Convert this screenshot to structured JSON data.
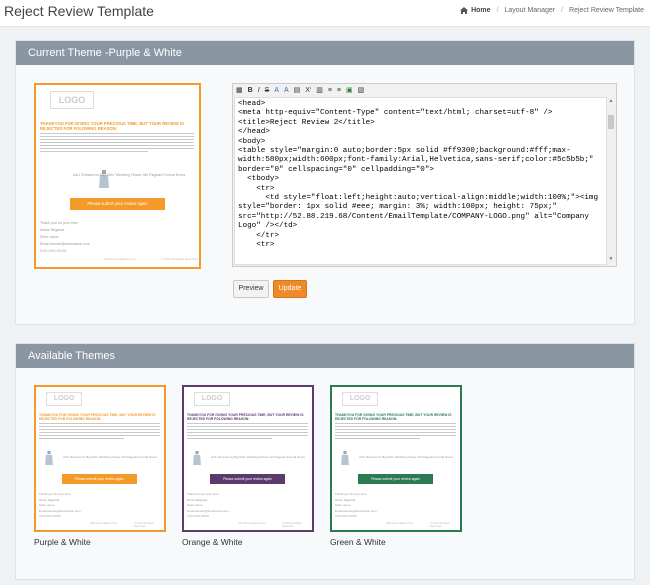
{
  "header": {
    "page_title": "Reject Review Template",
    "breadcrumbs": [
      "Home",
      "Layout Manager",
      "Reject Review Template"
    ]
  },
  "current_panel": {
    "title": "Current Theme -Purple & White"
  },
  "available_panel": {
    "title": "Available Themes"
  },
  "email": {
    "logo": "LOGO",
    "headline": "THANKYOU FOR GIVING YOUR PRECIOUS TIME, BUT YOUR REVIEW IS REJECTED FOR FOLOWING REASON:",
    "body": "Lorem ipsum dolor sit amet, consectetur adipisicing elit, sed do eiusmod tempor incididunt ut labore et dolore magna aliqua. Ut enim ad minim veniam, quis nostrud exercitation ullamco laboris nisi ut aliquip ex ea commodo consequat. Duis aute irure dolor in reprehenderit in voluptate velit esse cillum dolore eu fugiat nulla pariatur. Excepteur sint occaecat cupidatat non proident, sunt in culpa qui officia deserunt mollit anim id est laborum.",
    "product": "A4Li Dresses for Big Girls' Wedding Flower Girl Pageant Formal Dress",
    "cta": "Please submit your review again",
    "sig_lines": [
      "Thank you for your time",
      "Name Regards,",
      "Store name",
      "Email:service@storename.com",
      "XXX-XXX-XXXX"
    ],
    "footer_left": "Add Store address here",
    "footer_right": "© 2016 All Rights Reserved"
  },
  "editor": {
    "toolbar": [
      "▦",
      "B",
      "I",
      "S",
      "A",
      "A",
      "▤",
      "Xⁱ",
      "▥",
      "≡",
      "≡",
      "▣",
      "▧"
    ],
    "code": "<head>\n<meta http-equiv=\"Content-Type\" content=\"text/html; charset=utf-8\" />\n<title>Reject Review 2</title>\n</head>\n<body>\n<table style=\"margin:0 auto;border:5px solid #ff9300;background:#fff;max-\nwidth:580px;width:600px;font-family:Arial,Helvetica,sans-serif;color:#5c5b5b;\"\nborder=\"0\" cellspacing=\"0\" cellpadding=\"0\">\n  <tbody>\n    <tr>\n      <td style=\"float:left;height:auto;vertical-align:middle;width:100%;\"><img\nstyle=\"border: 1px solid #eee; margin: 3%; width:100px; height: 75px;\"\nsrc=\"http://52.88.219.68/Content/EmailTemplate/COMPANY-LOGO.png\" alt=\"Company\nLogo\" /></td>\n    </tr>\n    <tr>"
  },
  "buttons": {
    "preview": "Preview",
    "update": "Update"
  },
  "themes": [
    {
      "label": "Purple & White",
      "accent": "#f39a28"
    },
    {
      "label": "Orange & White",
      "accent": "#5d3a6e"
    },
    {
      "label": "Green & White",
      "accent": "#2b7a52"
    }
  ]
}
